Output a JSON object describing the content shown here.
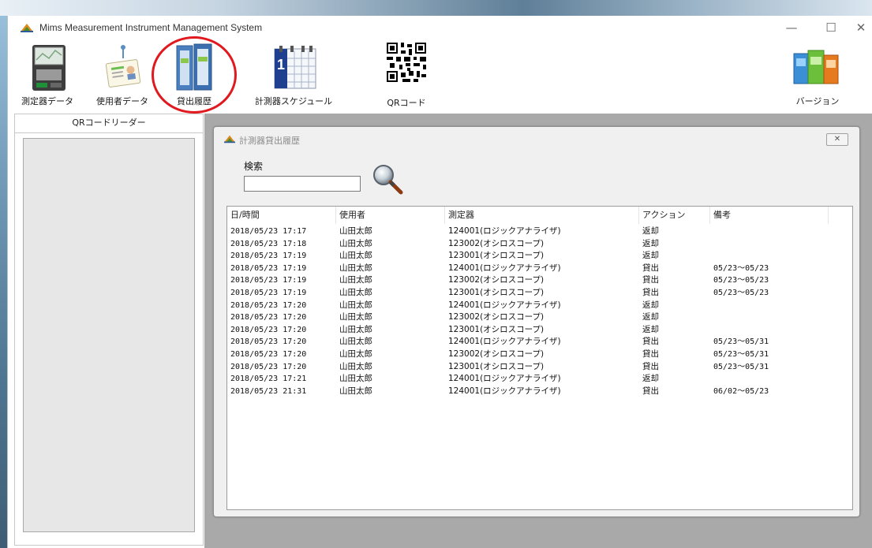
{
  "window": {
    "title": "Mims  Measurement Instrument Management System",
    "minimize": "—",
    "maximize": "☐",
    "close": "✕"
  },
  "toolbar": {
    "items": [
      {
        "label": "測定器データ",
        "icon": "instrument-device-icon"
      },
      {
        "label": "使用者データ",
        "icon": "id-badge-icon"
      },
      {
        "label": "貸出履歴",
        "icon": "binders-icon"
      },
      {
        "label": "計測器スケジュール",
        "icon": "calendar-icon"
      },
      {
        "label": "QRコード",
        "icon": "qr-code-icon"
      },
      {
        "label": "バージョン",
        "icon": "version-books-icon"
      }
    ]
  },
  "left_panel": {
    "tab": "QRコードリーダー"
  },
  "child_window": {
    "title": "計測器貸出履歴",
    "close": "✕",
    "search": {
      "label": "検索",
      "value": "",
      "button_icon": "magnifier-icon"
    },
    "columns": [
      "日/時間",
      "使用者",
      "測定器",
      "アクション",
      "備考"
    ],
    "rows": [
      {
        "date": "2018/05/23 17:17",
        "user": "山田太郎",
        "instrument": "124001(ロジックアナライザ)",
        "action": "返却",
        "note": ""
      },
      {
        "date": "2018/05/23 17:18",
        "user": "山田太郎",
        "instrument": "123002(オシロスコープ)",
        "action": "返却",
        "note": ""
      },
      {
        "date": "2018/05/23 17:19",
        "user": "山田太郎",
        "instrument": "123001(オシロスコープ)",
        "action": "返却",
        "note": ""
      },
      {
        "date": "2018/05/23 17:19",
        "user": "山田太郎",
        "instrument": "124001(ロジックアナライザ)",
        "action": "貸出",
        "note": "05/23～05/23"
      },
      {
        "date": "2018/05/23 17:19",
        "user": "山田太郎",
        "instrument": "123002(オシロスコープ)",
        "action": "貸出",
        "note": "05/23～05/23"
      },
      {
        "date": "2018/05/23 17:19",
        "user": "山田太郎",
        "instrument": "123001(オシロスコープ)",
        "action": "貸出",
        "note": "05/23～05/23"
      },
      {
        "date": "2018/05/23 17:20",
        "user": "山田太郎",
        "instrument": "124001(ロジックアナライザ)",
        "action": "返却",
        "note": ""
      },
      {
        "date": "2018/05/23 17:20",
        "user": "山田太郎",
        "instrument": "123002(オシロスコープ)",
        "action": "返却",
        "note": ""
      },
      {
        "date": "2018/05/23 17:20",
        "user": "山田太郎",
        "instrument": "123001(オシロスコープ)",
        "action": "返却",
        "note": ""
      },
      {
        "date": "2018/05/23 17:20",
        "user": "山田太郎",
        "instrument": "124001(ロジックアナライザ)",
        "action": "貸出",
        "note": "05/23～05/31"
      },
      {
        "date": "2018/05/23 17:20",
        "user": "山田太郎",
        "instrument": "123002(オシロスコープ)",
        "action": "貸出",
        "note": "05/23～05/31"
      },
      {
        "date": "2018/05/23 17:20",
        "user": "山田太郎",
        "instrument": "123001(オシロスコープ)",
        "action": "貸出",
        "note": "05/23～05/31"
      },
      {
        "date": "2018/05/23 17:21",
        "user": "山田太郎",
        "instrument": "124001(ロジックアナライザ)",
        "action": "返却",
        "note": ""
      },
      {
        "date": "2018/05/23 21:31",
        "user": "山田太郎",
        "instrument": "124001(ロジックアナライザ)",
        "action": "貸出",
        "note": "06/02～05/23"
      }
    ]
  },
  "colors": {
    "highlight": "#e0191f",
    "workspace": "#a9a9a9",
    "panel": "#f0f0f0"
  }
}
